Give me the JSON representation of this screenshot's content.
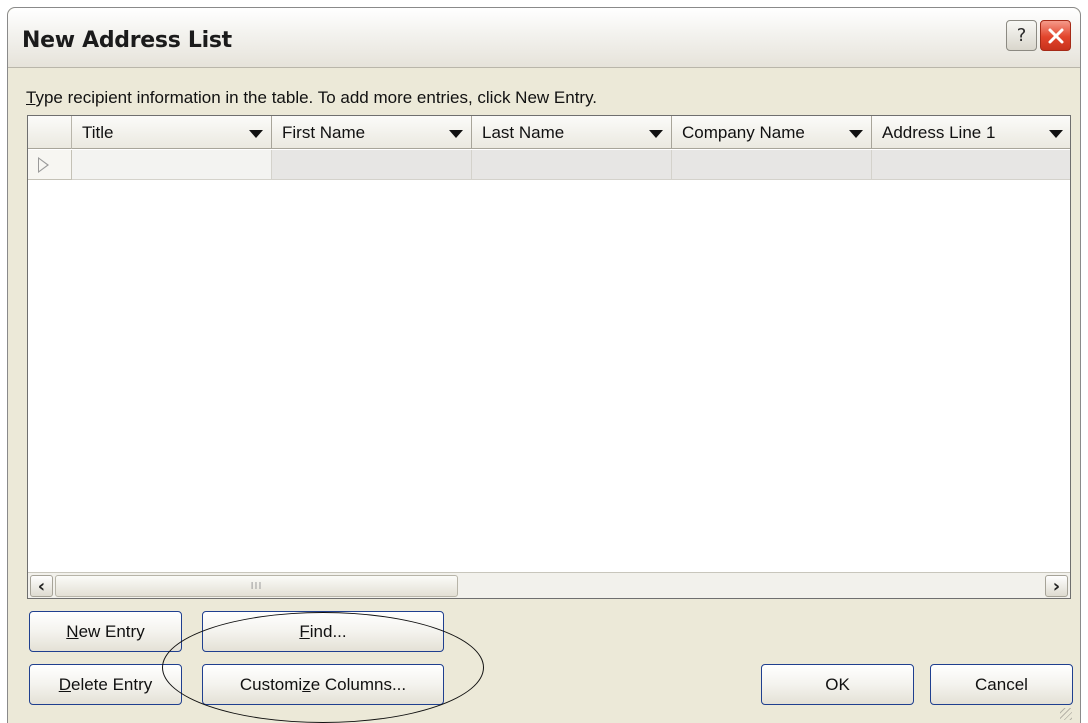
{
  "window": {
    "title": "New Address List",
    "help_glyph": "?",
    "close_icon": "close-icon"
  },
  "instruction": {
    "first_letter": "T",
    "rest": "ype recipient information in the table.  To add more entries, click New Entry."
  },
  "table": {
    "columns": [
      {
        "label": "Title"
      },
      {
        "label": "First Name"
      },
      {
        "label": "Last Name"
      },
      {
        "label": "Company Name"
      },
      {
        "label": "Address Line 1"
      }
    ],
    "rows": [
      {
        "cells": [
          "",
          "",
          "",
          "",
          ""
        ]
      }
    ],
    "scrollbar": {
      "left_arrow": "‹",
      "right_arrow": "›",
      "grip": "III"
    }
  },
  "buttons": {
    "new_entry": {
      "mnemonic": "N",
      "rest": "ew Entry"
    },
    "find": {
      "mnemonic": "F",
      "rest": "ind..."
    },
    "delete_entry": {
      "mnemonic": "D",
      "rest": "elete Entry"
    },
    "customize_columns": {
      "pre": "Customi",
      "mnemonic": "z",
      "rest": "e Columns..."
    },
    "ok": "OK",
    "cancel": "Cancel"
  }
}
